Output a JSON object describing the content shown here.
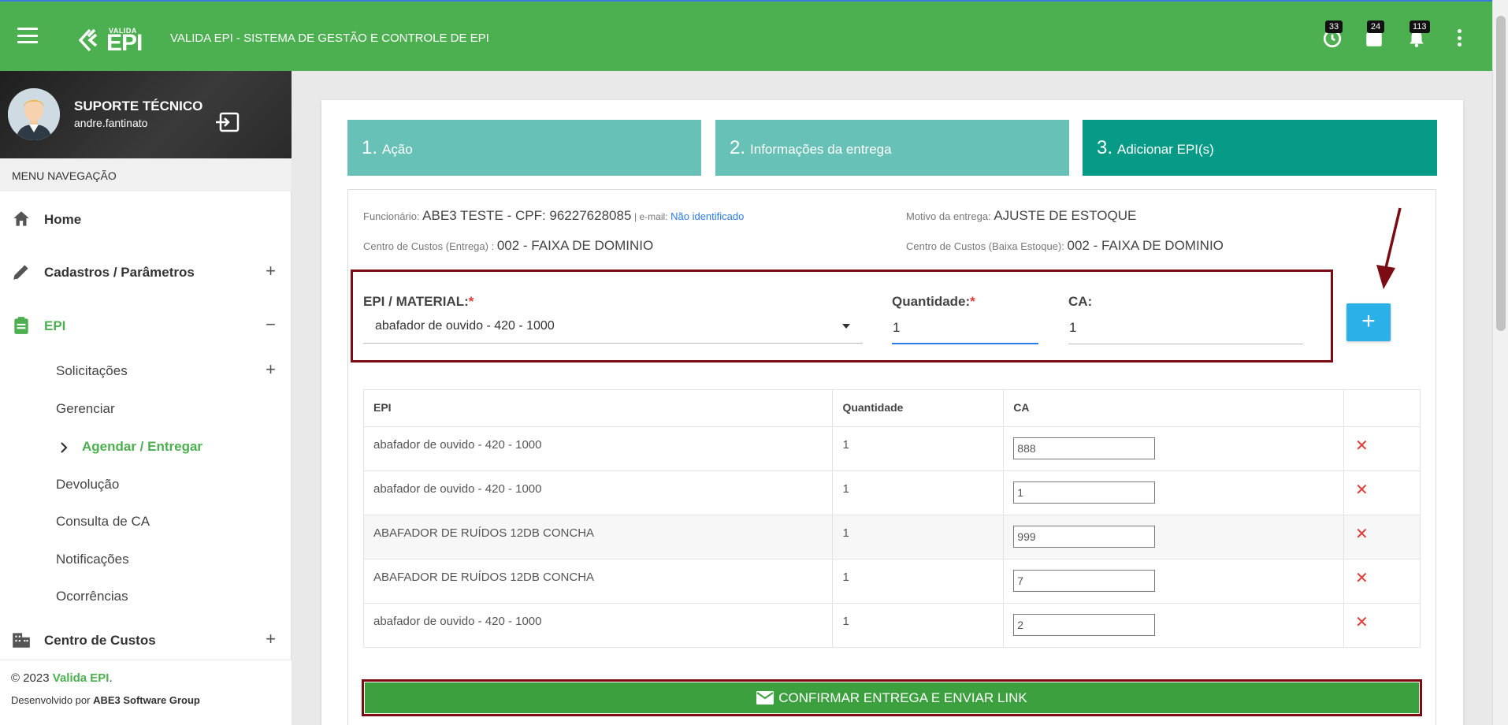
{
  "header": {
    "logo_small": "VALIDA",
    "logo_big": "EPI",
    "app_title": "VALIDA EPI - SISTEMA DE GESTÃO E CONTROLE DE EPI",
    "badges": {
      "clock": "33",
      "calendar": "24",
      "bell": "113"
    }
  },
  "user": {
    "name": "SUPORTE TÉCNICO",
    "login": "andre.fantinato"
  },
  "sidebar": {
    "menu_title": "MENU NAVEGAÇÃO",
    "items": {
      "home": "Home",
      "cadastros": "Cadastros / Parâmetros",
      "epi": "EPI",
      "solicitacoes": "Solicitações",
      "gerenciar": "Gerenciar",
      "agendar": "Agendar / Entregar",
      "devolucao": "Devolução",
      "consulta_ca": "Consulta de CA",
      "notificacoes": "Notificações",
      "ocorrencias": "Ocorrências",
      "centro_custos": "Centro de Custos"
    },
    "plus": "+",
    "minus": "−",
    "footer_copy": "© 2023 ",
    "footer_brand": "Valida EPI",
    "footer_dot": ".",
    "footer_dev": "Desenvolvido por ",
    "footer_company": "ABE3 Software Group"
  },
  "steps": [
    {
      "num": "1.",
      "label": "Ação"
    },
    {
      "num": "2.",
      "label": "Informações da entrega"
    },
    {
      "num": "3.",
      "label": "Adicionar EPI(s)"
    }
  ],
  "info": {
    "funcionario_label": "Funcionário:",
    "funcionario_value": "ABE3 TESTE - CPF: 96227628085",
    "email_label": "| e-mail:",
    "email_value": "Não identificado",
    "motivo_label": "Motivo da entrega:",
    "motivo_value": "AJUSTE DE ESTOQUE",
    "cc_entrega_label": "Centro de Custos (Entrega) :",
    "cc_entrega_value": "002 - FAIXA DE DOMINIO",
    "cc_baixa_label": "Centro de Custos (Baixa Estoque):",
    "cc_baixa_value": "002 - FAIXA DE DOMINIO"
  },
  "form": {
    "epi_label": "EPI / MATERIAL:",
    "epi_value": "abafador de ouvido - 420 - 1000",
    "qty_label": "Quantidade:",
    "qty_value": "1",
    "ca_label": "CA:",
    "ca_value": "1",
    "required_mark": "*",
    "add_label": "+"
  },
  "table": {
    "headers": {
      "epi": "EPI",
      "qty": "Quantidade",
      "ca": "CA"
    },
    "rows": [
      {
        "epi": "abafador de ouvido - 420 - 1000",
        "qty": "1",
        "ca": "888"
      },
      {
        "epi": "abafador de ouvido - 420 - 1000",
        "qty": "1",
        "ca": "1"
      },
      {
        "epi": "ABAFADOR DE RUÍDOS 12DB CONCHA",
        "qty": "1",
        "ca": "999"
      },
      {
        "epi": "ABAFADOR DE RUÍDOS 12DB CONCHA",
        "qty": "1",
        "ca": "7"
      },
      {
        "epi": "abafador de ouvido - 420 - 1000",
        "qty": "1",
        "ca": "2"
      }
    ],
    "delete_glyph": "✕"
  },
  "confirm_label": "CONFIRMAR ENTREGA E ENVIAR LINK",
  "colors": {
    "topbar": "#4caf50",
    "step_light": "#67c1b7",
    "step_active": "#079a87",
    "add_button": "#2bb1e8",
    "confirm_button": "#3ca03f",
    "annotation": "#7b0c13",
    "delete": "#e53935"
  }
}
